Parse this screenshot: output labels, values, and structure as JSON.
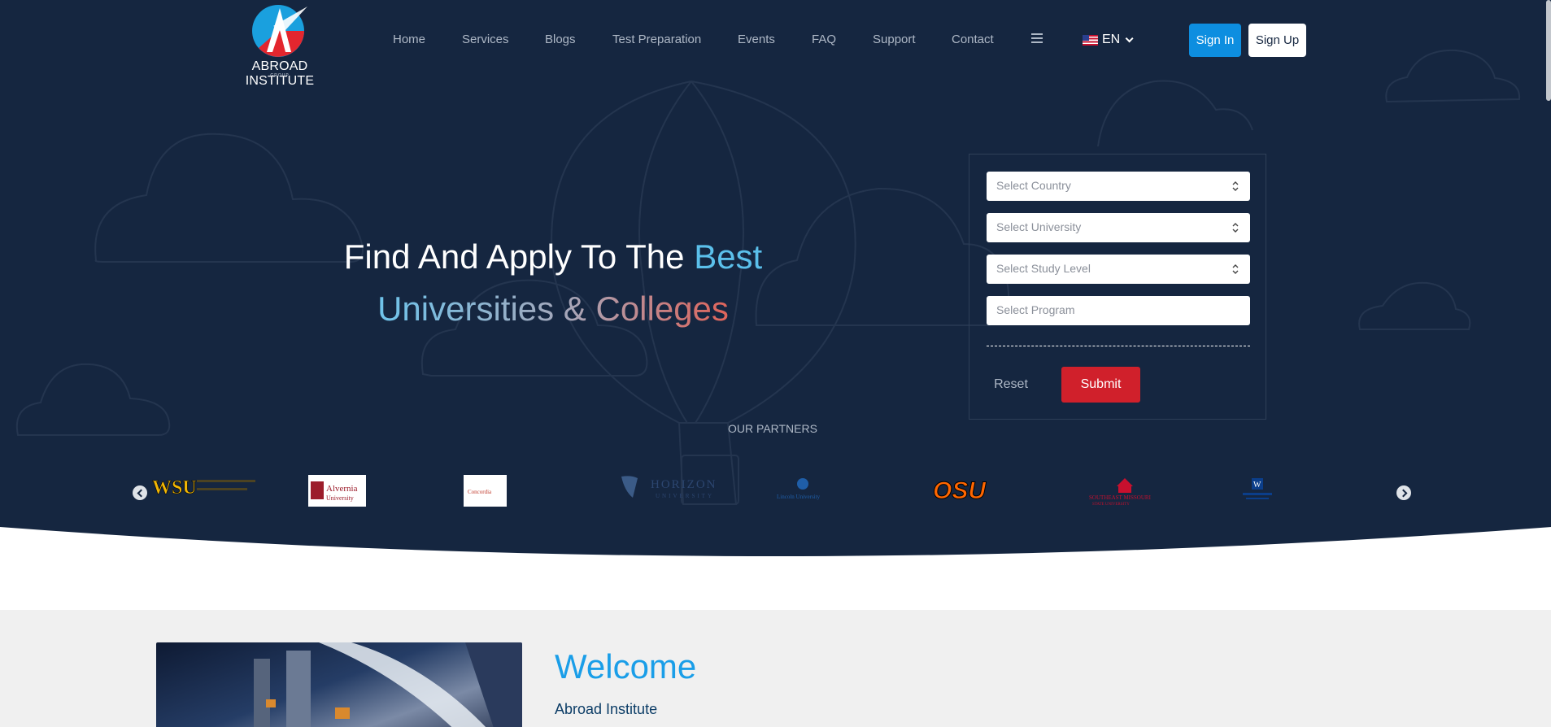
{
  "brand": {
    "name": "ABROAD INSTITUTE",
    "sub": "GROUP"
  },
  "nav": [
    {
      "label": "Home"
    },
    {
      "label": "Services"
    },
    {
      "label": "Blogs"
    },
    {
      "label": "Test Preparation"
    },
    {
      "label": "Events"
    },
    {
      "label": "FAQ"
    },
    {
      "label": "Support"
    },
    {
      "label": "Contact"
    }
  ],
  "lang": {
    "code": "EN"
  },
  "auth": {
    "signin": "Sign In",
    "signup": "Sign Up"
  },
  "hero": {
    "line1": "Find And Apply To The",
    "best": "Best",
    "line2": "Universities & Colleges"
  },
  "form": {
    "country_placeholder": "Select Country",
    "university_placeholder": "Select University",
    "level_placeholder": "Select Study Level",
    "program_placeholder": "Select Program",
    "reset": "Reset",
    "submit": "Submit"
  },
  "partners": {
    "title": "OUR PARTNERS",
    "logos": [
      "WSU",
      "Alvernia University",
      "Concordia",
      "HORIZON UNIVERSITY",
      "Lincoln University",
      "OSU",
      "SOUTHEAST MISSOURI STATE UNIVERSITY",
      "W"
    ]
  },
  "welcome": {
    "title": "Welcome",
    "subtitle": "Abroad Institute"
  },
  "colors": {
    "hero_bg": "#152640",
    "accent_blue": "#0d8ee0",
    "submit_red": "#d0202b",
    "welcome_blue": "#1a9ee8"
  }
}
